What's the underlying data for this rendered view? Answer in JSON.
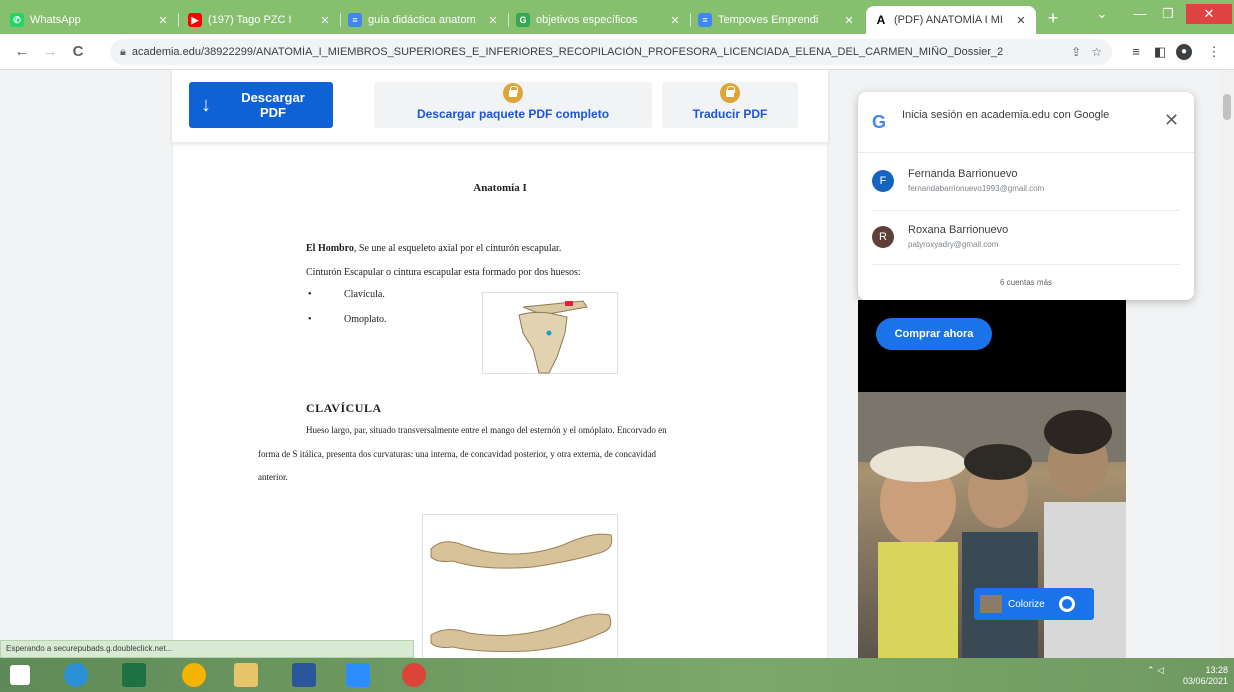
{
  "browser": {
    "tabs": [
      {
        "title": "WhatsApp",
        "icon": "whatsapp-icon",
        "color": "#25d366"
      },
      {
        "title": "(197) Tago PZC I",
        "icon": "youtube-icon",
        "color": "#ff0000"
      },
      {
        "title": "guía didáctica anatom",
        "icon": "docs-icon",
        "color": "#4285f4"
      },
      {
        "title": "objetivos específicos",
        "icon": "google-icon",
        "color": "#34a853"
      },
      {
        "title": "Tempoves Emprendi",
        "icon": "docs-icon",
        "color": "#4285f4"
      },
      {
        "title": "(PDF) ANATOMÍA I MI",
        "icon": "academia-icon",
        "color": "#ffffff",
        "active": true
      }
    ],
    "new_tab": "+",
    "address": "academia.edu/38922299/ANATOMÍA_I_MIEMBROS_SUPERIORES_E_INFERIORES_RECOPILACIÓN_PROFESORA_LICENCIADA_ELENA_DEL_CARMEN_MIÑO_Dossier_2"
  },
  "toolbar_buttons": {
    "download": "Descargar PDF",
    "download_line1": "Descargar",
    "download_line2": "PDF",
    "bundle": "Descargar paquete PDF completo",
    "translate": "Traducir PDF"
  },
  "document": {
    "title": "Anatomía I",
    "intro_bold": "El Hombro",
    "intro_rest": ", Se une al esqueleto axial por el cinturón escapular.",
    "line2": "Cinturón Escapular o cintura escapular esta formado por dos huesos:",
    "bullets": [
      "Clavicula.",
      "Omoplato."
    ],
    "section": "CLAVÍCULA",
    "body1": "Hueso largo, par,  situado transversalmente entre el mango del esternón y el omóplato. Encorvado en",
    "body2": "forma de S itálica, presenta dos curvaturas: una interna, de concavidad  posterior, y otra externa, de concavidad",
    "body3": "anterior."
  },
  "google_signin": {
    "heading": "Inicia sesión en academia.edu con Google",
    "accounts": [
      {
        "name": "Fernanda Barrionuevo",
        "email": "fernandabarrionuevo1993@gmail.com",
        "initial": "F",
        "color": "#1565c0"
      },
      {
        "name": "Roxana Barrionuevo",
        "email": "patyroxyadry@gmail.com",
        "initial": "R",
        "color": "#5d4037"
      }
    ],
    "more": "6 cuentas más"
  },
  "ad": {
    "cta": "Comprar ahora",
    "colorize": "Colorize"
  },
  "status_text": "Esperando a securepubads.g.doubleclick.net...",
  "tray": {
    "time": "13:28",
    "date": "03/06/2021"
  }
}
